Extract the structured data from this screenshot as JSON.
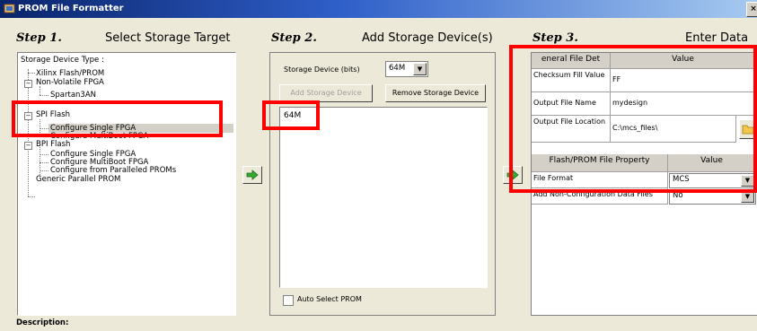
{
  "window": {
    "title": "PROM File Formatter",
    "close_label": "×"
  },
  "steps": [
    {
      "title": "Step 1.",
      "subtitle": "Select Storage Target"
    },
    {
      "title": "Step 2.",
      "subtitle": "Add Storage Device(s)"
    },
    {
      "title": "Step 3.",
      "subtitle": "Enter Data"
    }
  ],
  "step1": {
    "header": "Storage Device Type :",
    "tree": [
      {
        "label": "Xilinx Flash/PROM",
        "level": 0
      },
      {
        "label": "Non-Volatile FPGA",
        "level": 0,
        "expander": "−"
      },
      {
        "label": "Spartan3AN",
        "level": 1
      },
      {
        "label": "SPI Flash",
        "level": 0,
        "expander": "−"
      },
      {
        "label": "Configure Single FPGA",
        "level": 1,
        "selected": true
      },
      {
        "label": "Configure MultiBoot FPGA",
        "level": 1
      },
      {
        "label": "BPI Flash",
        "level": 0,
        "expander": "−"
      },
      {
        "label": "Configure Single FPGA",
        "level": 1
      },
      {
        "label": "Configure MultiBoot FPGA",
        "level": 1
      },
      {
        "label": "Configure from Paralleled PROMs",
        "level": 1
      },
      {
        "label": "Generic Parallel PROM",
        "level": 0
      }
    ]
  },
  "step2": {
    "storage_label": "Storage Device (bits)",
    "storage_value": "64M",
    "add_button": "Add Storage Device",
    "remove_button": "Remove Storage Device",
    "devices": [
      "64M"
    ],
    "auto_select": "Auto Select PROM"
  },
  "step3": {
    "general_header": "eneral File Det",
    "value_header": "Value",
    "general_rows": [
      {
        "label": "Checksum Fill Value",
        "value": "FF"
      },
      {
        "label": "Output File Name",
        "value": "mydesign"
      },
      {
        "label": "Output File Location",
        "value": "C:\\mcs_files\\"
      }
    ],
    "flash_header": "Flash/PROM File Property",
    "flash_value_header": "Value",
    "flash_rows": [
      {
        "label": "File Format",
        "value": "MCS"
      },
      {
        "label": "Add Non-Configuration Data Files",
        "value": "No"
      }
    ]
  },
  "description_label": "Description:",
  "icons": {
    "app": "prom-app-icon",
    "arrow": "green-right-arrow-icon",
    "folder": "folder-icon",
    "dropdown": "chevron-down-icon"
  },
  "colors": {
    "highlight": "#ff0000",
    "arrow": "#33aa33"
  }
}
